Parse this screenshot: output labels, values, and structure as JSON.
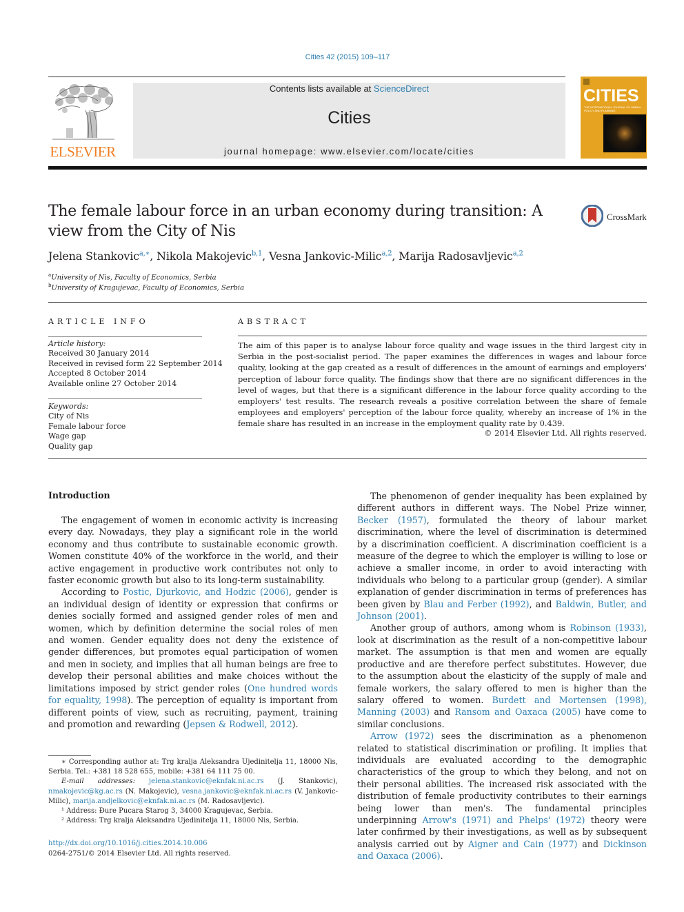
{
  "header": {
    "journal_ref": "Cities 42 (2015) 109–117",
    "contents_prefix": "Contents lists available at ",
    "contents_link": "ScienceDirect",
    "journal_name": "Cities",
    "homepage": "journal homepage: www.elsevier.com/locate/cities",
    "publisher_logo_text": "ELSEVIER",
    "cover_title": "CITIES",
    "cover_subtitle": "THE INTERNATIONAL JOURNAL OF URBAN POLICY AND PLANNING",
    "colors": {
      "link": "#2e7fb0",
      "elsevier_orange": "#ef7d22",
      "cover_yellow": "#e5a321",
      "header_gray": "#e8e8e8"
    }
  },
  "article": {
    "title": "The female labour force in an urban economy during transition: A view from the City of Nis",
    "crossmark_label": "CrossMark",
    "authors": [
      {
        "name": "Jelena Stankovic",
        "sup": "a,∗"
      },
      {
        "name": "Nikola Makojevic",
        "sup": "b,1"
      },
      {
        "name": "Vesna Jankovic-Milic",
        "sup": "a,2"
      },
      {
        "name": "Marija Radosavljevic",
        "sup": "a,2"
      }
    ],
    "affiliations": [
      {
        "key": "a",
        "text": "University of Nis, Faculty of Economics, Serbia"
      },
      {
        "key": "b",
        "text": "University of Kragujevac, Faculty of Economics, Serbia"
      }
    ]
  },
  "article_info": {
    "heading": "ARTICLE INFO",
    "history_label": "Article history:",
    "history": [
      "Received 30 January 2014",
      "Received in revised form 22 September 2014",
      "Accepted 8 October 2014",
      "Available online 27 October 2014"
    ],
    "keywords_label": "Keywords:",
    "keywords": [
      "City of Nis",
      "Female labour force",
      "Wage gap",
      "Quality gap"
    ]
  },
  "abstract": {
    "heading": "ABSTRACT",
    "text": "The aim of this paper is to analyse labour force quality and wage issues in the third largest city in Serbia in the post-socialist period. The paper examines the differences in wages and labour force quality, looking at the gap created as a result of differences in the amount of earnings and employers' perception of labour force quality. The findings show that there are no significant differences in the level of wages, but that there is a significant difference in the labour force quality according to the employers' test results. The research reveals a positive correlation between the share of female employees and employers' perception of the labour force quality, whereby an increase of 1% in the female share has resulted in an increase in the employment quality rate by 0.439.",
    "copyright": "© 2014 Elsevier Ltd. All rights reserved."
  },
  "body": {
    "intro_heading": "Introduction",
    "col1_p1": "The engagement of women in economic activity is increasing every day. Nowadays, they play a significant role in the world economy and thus contribute to sustainable economic growth. Women constitute 40% of the workforce in the world, and their active engagement in productive work contributes not only to faster economic growth but also to its long-term sustainability.",
    "col1_p2": [
      {
        "t": "According to "
      },
      {
        "link": "Postic, Djurkovic, and Hodzic (2006)"
      },
      {
        "t": ", gender is an individual design of identity or expression that confirms or denies socially formed and assigned gender roles of men and women, which by definition determine the social roles of men and women. Gender equality does not deny the existence of gender differences, but promotes equal participation of women and men in society, and implies that all human beings are free to develop their personal abilities and make choices without the limitations imposed by strict gender roles ("
      },
      {
        "link": "One hundred words for equality, 1998"
      },
      {
        "t": "). The perception of equality is important from different points of view, such as recruiting, payment, training and promotion and rewarding ("
      },
      {
        "link": "Jepsen & Rodwell, 2012"
      },
      {
        "t": ")."
      }
    ],
    "col2_p1": [
      {
        "t": "The phenomenon of gender inequality has been explained by different authors in different ways. The Nobel Prize winner, "
      },
      {
        "link": "Becker (1957)"
      },
      {
        "t": ", formulated the theory of labour market discrimination, where the level of discrimination is determined by a discrimination coefficient. A discrimination coefficient is a measure of the degree to which the employer is willing to lose or achieve a smaller income, in order to avoid interacting with individuals who belong to a particular group (gender). A similar explanation of gender discrimination in terms of preferences has been given by "
      },
      {
        "link": "Blau and Ferber (1992)"
      },
      {
        "t": ", and "
      },
      {
        "link": "Baldwin, Butler, and Johnson (2001)"
      },
      {
        "t": "."
      }
    ],
    "col2_p2": [
      {
        "t": "Another group of authors, among whom is "
      },
      {
        "link": "Robinson (1933)"
      },
      {
        "t": ", look at discrimination as the result of a non-competitive labour market. The assumption is that men and women are equally productive and are therefore perfect substitutes. However, due to the assumption about the elasticity of the supply of male and female workers, the salary offered to men is higher than the salary offered to women. "
      },
      {
        "link": "Burdett and Mortensen (1998), Manning (2003)"
      },
      {
        "t": " and "
      },
      {
        "link": "Ransom and Oaxaca (2005)"
      },
      {
        "t": " have come to similar conclusions."
      }
    ],
    "col2_p3": [
      {
        "link": "Arrow (1972)"
      },
      {
        "t": " sees the discrimination as a phenomenon related to statistical discrimination or profiling. It implies that individuals are evaluated according to the demographic characteristics of the group to which they belong, and not on their personal abilities. The increased risk associated with the distribution of female productivity contributes to their earnings being lower than men's. The fundamental principles underpinning "
      },
      {
        "link": "Arrow's (1971) and Phelps' (1972)"
      },
      {
        "t": " theory were later confirmed by their investigations, as well as by subsequent analysis carried out by "
      },
      {
        "link": "Aigner and Cain (1977)"
      },
      {
        "t": " and "
      },
      {
        "link": "Dickinson and Oaxaca (2006)"
      },
      {
        "t": "."
      }
    ]
  },
  "footnotes": {
    "corresponding": "∗ Corresponding author at: Trg kralja Aleksandra Ujedinitelja 11, 18000 Nis, Serbia. Tel.: +381 18 528 655, mobile: +381 64 111 75 00.",
    "email_label": "E-mail addresses: ",
    "emails": [
      {
        "email": "jelena.stankovic@eknfak.ni.ac.rs",
        "who": " (J. Stankovic), "
      },
      {
        "email": "nmakojevic@kg.ac.rs",
        "who": " (N. Makojevic), "
      },
      {
        "email": "vesna.jankovic@eknfak.ni.ac.rs",
        "who": " (V. Jankovic-Milic), "
      },
      {
        "email": "marija.andjelkovic@eknfak.ni.ac.rs",
        "who": " (M. Radosavljevic)."
      }
    ],
    "fn1": "¹ Address: Đure Pucara Starog 3, 34000 Kragujevac, Serbia.",
    "fn2": "² Address: Trg kralja Aleksandra Ujedinitelja 11, 18000 Nis, Serbia.",
    "doi": "http://dx.doi.org/10.1016/j.cities.2014.10.006",
    "issn": "0264-2751/© 2014 Elsevier Ltd. All rights reserved."
  }
}
